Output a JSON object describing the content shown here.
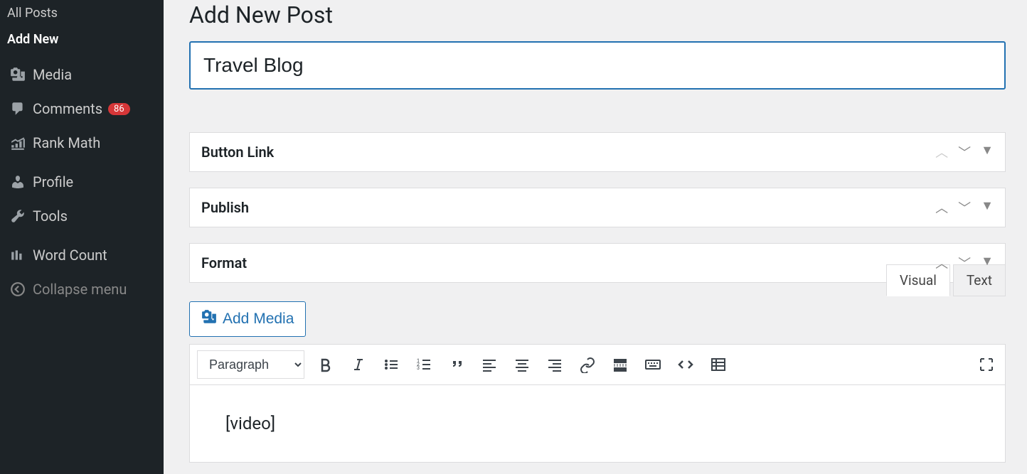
{
  "sidebar": {
    "sub_all_posts": "All Posts",
    "sub_add_new": "Add New",
    "media": "Media",
    "comments": "Comments",
    "comments_count": "86",
    "rank_math": "Rank Math",
    "profile": "Profile",
    "tools": "Tools",
    "word_count": "Word Count",
    "collapse": "Collapse menu"
  },
  "page": {
    "title": "Add New Post",
    "post_title": "Travel Blog"
  },
  "metaboxes": {
    "button_link": "Button Link",
    "publish": "Publish",
    "format": "Format"
  },
  "editor": {
    "add_media": "Add Media",
    "tab_visual": "Visual",
    "tab_text": "Text",
    "paragraph": "Paragraph",
    "content": "[video]"
  }
}
